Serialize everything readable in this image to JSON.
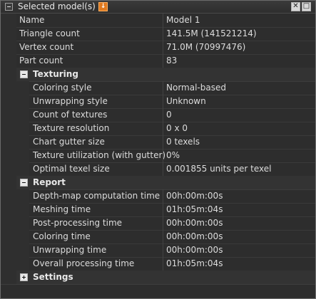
{
  "title": "Selected model(s)",
  "icons": {
    "pin": "pin-icon",
    "close": "close-icon",
    "maximize": "maximize-icon",
    "collapse": "collapse-icon"
  },
  "colors": {
    "pin_accent": "#e07a20",
    "background": "#2b2b2b"
  },
  "top_rows": [
    {
      "name": "Name",
      "value": "Model 1"
    },
    {
      "name": "Triangle count",
      "value": "141.5M (141521214)"
    },
    {
      "name": "Vertex count",
      "value": "71.0M (70997476)"
    },
    {
      "name": "Part count",
      "value": "83"
    }
  ],
  "groups": [
    {
      "label": "Texturing",
      "expanded": true,
      "rows": [
        {
          "name": "Coloring style",
          "value": "Normal-based"
        },
        {
          "name": "Unwrapping style",
          "value": "Unknown"
        },
        {
          "name": "Count of textures",
          "value": "0"
        },
        {
          "name": "Texture resolution",
          "value": "0 x 0"
        },
        {
          "name": "Chart gutter size",
          "value": "0 texels"
        },
        {
          "name": "Texture utilization (with gutter)",
          "value": "0%"
        },
        {
          "name": "Optimal texel size",
          "value": "0.001855 units per texel"
        }
      ]
    },
    {
      "label": "Report",
      "expanded": true,
      "rows": [
        {
          "name": "Depth-map computation time",
          "value": "00h:00m:00s"
        },
        {
          "name": "Meshing time",
          "value": "01h:05m:04s"
        },
        {
          "name": "Post-processing time",
          "value": "00h:00m:00s"
        },
        {
          "name": "Coloring time",
          "value": "00h:00m:00s"
        },
        {
          "name": "Unwrapping time",
          "value": "00h:00m:00s"
        },
        {
          "name": "Overall processing time",
          "value": "01h:05m:04s"
        }
      ]
    },
    {
      "label": "Settings",
      "expanded": false,
      "rows": []
    }
  ]
}
